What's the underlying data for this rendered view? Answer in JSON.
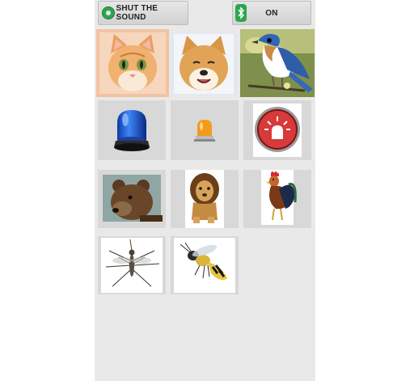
{
  "toolbar": {
    "shut_label": "SHUT THE SOUND",
    "bt_label": "ON"
  },
  "colors": {
    "accent_green": "#2ea44f",
    "panel_bg": "#e9e9e9",
    "tile_bg": "#d8d8d8"
  },
  "grid": {
    "row1": [
      "cat-icon",
      "dog-icon",
      "bird-icon"
    ],
    "row2": [
      "police-light-icon",
      "orange-beacon-icon",
      "alarm-button-icon"
    ],
    "row3": [
      "bear-icon",
      "lion-icon",
      "rooster-icon"
    ],
    "row4": [
      "mosquito-icon",
      "wasp-icon"
    ]
  }
}
